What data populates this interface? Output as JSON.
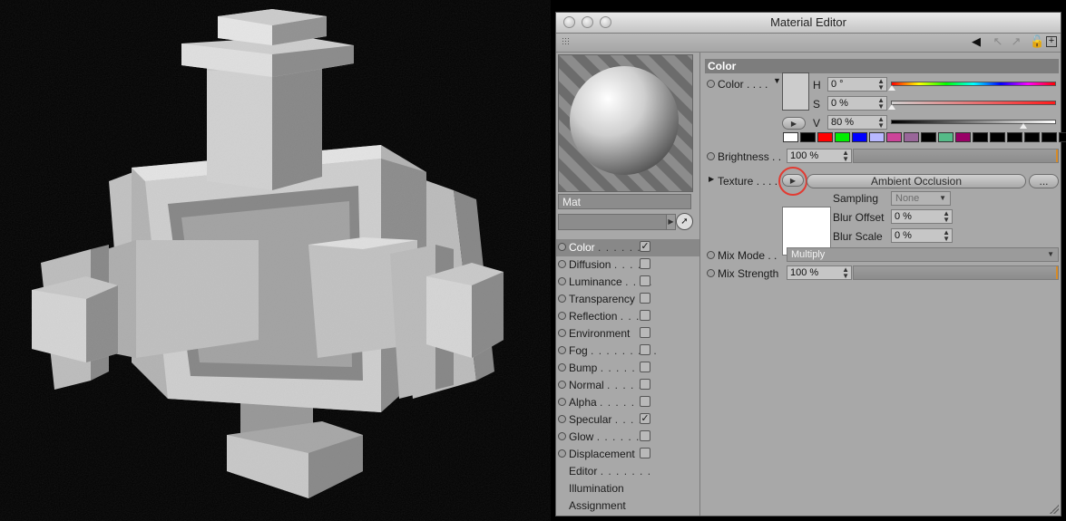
{
  "window": {
    "title": "Material Editor"
  },
  "material": {
    "name": "Mat"
  },
  "channels": [
    {
      "label": "Color",
      "dots": ". . . . . . .",
      "checked": true,
      "active": true
    },
    {
      "label": "Diffusion",
      "dots": ". . . . .",
      "checked": false
    },
    {
      "label": "Luminance",
      "dots": ". . . .",
      "checked": false
    },
    {
      "label": "Transparency",
      "dots": "",
      "checked": false
    },
    {
      "label": "Reflection",
      "dots": ". . .",
      "checked": false
    },
    {
      "label": "Environment",
      "dots": "",
      "checked": false
    },
    {
      "label": "Fog",
      "dots": ". . . . . . . . .",
      "checked": false
    },
    {
      "label": "Bump",
      "dots": ". . . . . . .",
      "checked": false
    },
    {
      "label": "Normal",
      "dots": ". . . . .",
      "checked": false
    },
    {
      "label": "Alpha",
      "dots": ". . . . . . .",
      "checked": false
    },
    {
      "label": "Specular",
      "dots": ". . . .",
      "checked": true
    },
    {
      "label": "Glow",
      "dots": ". . . . . . .",
      "checked": false
    },
    {
      "label": "Displacement",
      "dots": "",
      "checked": false
    }
  ],
  "extras": [
    {
      "label": "Editor",
      "dots": ". . . . . . ."
    },
    {
      "label": "Illumination",
      "dots": ""
    },
    {
      "label": "Assignment",
      "dots": ""
    }
  ],
  "color_section": {
    "header": "Color",
    "color_label": "Color",
    "color_dots": ". . . .",
    "h_label": "H",
    "h_value": "0 °",
    "s_label": "S",
    "s_value": "0 %",
    "v_label": "V",
    "v_value": "80 %",
    "v_level": 0.8,
    "brightness_label": "Brightness",
    "brightness_dots": ". .",
    "brightness_value": "100 %",
    "texture_label": "Texture",
    "texture_dots": ". . . .",
    "texture_name": "Ambient Occlusion",
    "texture_more": "...",
    "sampling_label": "Sampling",
    "sampling_value": "None",
    "blur_offset_label": "Blur Offset",
    "blur_offset_value": "0 %",
    "blur_scale_label": "Blur Scale",
    "blur_scale_value": "0 %",
    "mix_mode_label": "Mix Mode",
    "mix_mode_dots": ". .",
    "mix_mode_value": "Multiply",
    "mix_strength_label": "Mix Strength",
    "mix_strength_value": "100 %",
    "palette": [
      "#ffffff",
      "#000000",
      "#ff0000",
      "#00ee00",
      "#0000ff",
      "#b8b8ff",
      "#cc4499",
      "#996699",
      "#000000",
      "#55bb88",
      "#990066",
      "#000000",
      "#000000",
      "#000000",
      "#000000",
      "#000000",
      "#000000",
      "#000000"
    ]
  },
  "colors": {
    "highlight": "#e23b32",
    "panel": "#a8a8a8",
    "accent": "#d88c28"
  }
}
